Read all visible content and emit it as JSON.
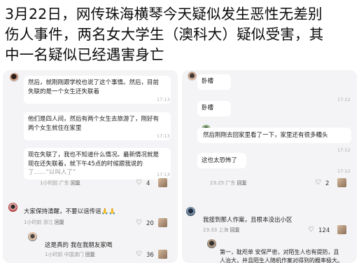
{
  "headline": {
    "line1": "3月22日，网传珠海横琴今天疑似发生恶性无差别",
    "line2": "伤人事件，两名女大学生（澳科大）疑似受害，其",
    "line3": "中一名疑似已经遇害身亡"
  },
  "left_panel": {
    "messages": [
      {
        "text": "然后，就刚刚跟学校也说了这个事情。然后，目前",
        "time": ""
      },
      {
        "text": "失联的是一个女生还失联着",
        "time": "17:13"
      },
      {
        "text": "他们是四人间，然后有两个女生去旅游了，刚好有",
        "time": ""
      },
      {
        "text": "两个女生就住在家里",
        "time": "17:13"
      },
      {
        "text": "现在失联了，我也不知道什么情况。最新情况就是",
        "time": ""
      },
      {
        "text": "现在还失联着，就下午45点的时候跟我说的",
        "time": "17:13"
      },
      {
        "text": "了……”以叫人了”",
        "time": ""
      }
    ],
    "post_meta": {
      "ago": "1小时前",
      "location": "广东",
      "reply": "回复",
      "likes": "4"
    },
    "comment1": {
      "text": "大家保持清醒，不要以谣传谣🙏🙏",
      "ago": "1小时前",
      "location": "浙江",
      "reply": "回复",
      "likes": "20"
    },
    "comment2": {
      "text": "这是真的 我在我朋友家喝",
      "ago": "1小时前",
      "location": "中国澳门",
      "reply": "回复",
      "likes": "36"
    }
  },
  "right_panel": {
    "messages": [
      {
        "text": "卧槽",
        "time": "17:12"
      },
      {
        "text": "卧槽",
        "time": ""
      },
      {
        "text": "然后刚刚去回家里看了一下，家里还有很多糟头",
        "time": "17:12"
      },
      {
        "text": "这也太恐怖了",
        "time": "17:12"
      }
    ],
    "post_meta": {
      "time": "23:25",
      "location": "广东",
      "reply": "回复",
      "likes": "2"
    },
    "comment1": {
      "text": "我接到那人作案，且根本没出小区",
      "time": "23:33",
      "location": "上海",
      "reply": "回复",
      "likes": "124"
    },
    "comment2": {
      "text": "第一，耽咫单 安保严密，对陌生人也有提防，且",
      "text2": "人治大，并且陌生人随机作案对得到的概率极大。"
    }
  }
}
